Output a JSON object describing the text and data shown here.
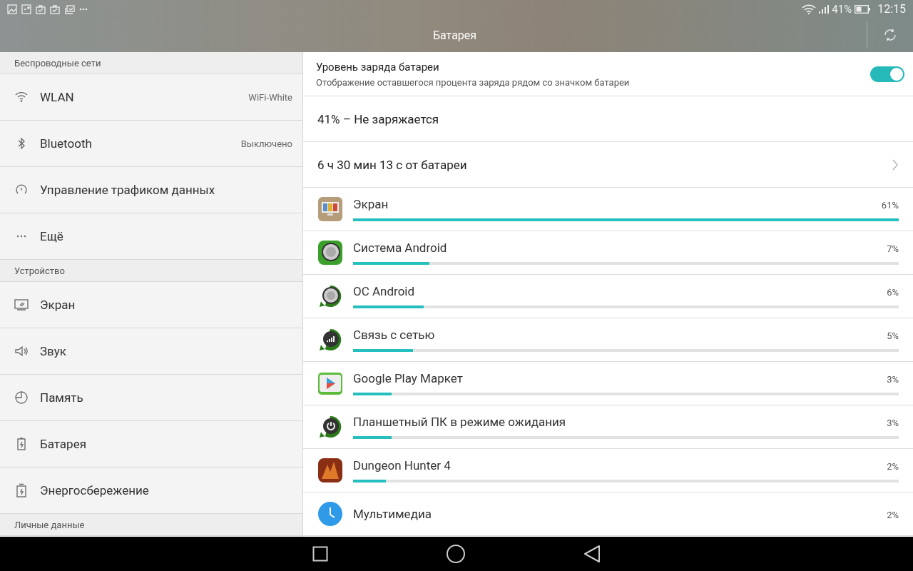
{
  "status_bar": {
    "battery": "41%",
    "time": "12:15"
  },
  "title": "Батарея",
  "sidebar": [
    {
      "kind": "header",
      "label": "Беспроводные сети"
    },
    {
      "kind": "wifi",
      "label": "WLAN",
      "value": "WiFi-White"
    },
    {
      "kind": "bluetooth",
      "label": "Bluetooth",
      "value": "Выключено"
    },
    {
      "kind": "gauge",
      "label": "Управление трафиком данных"
    },
    {
      "kind": "dots",
      "label": "Ещё"
    },
    {
      "kind": "header",
      "label": "Устройство"
    },
    {
      "kind": "monitor",
      "label": "Экран"
    },
    {
      "kind": "speaker",
      "label": "Звук"
    },
    {
      "kind": "pie",
      "label": "Память"
    },
    {
      "kind": "battery",
      "label": "Батарея"
    },
    {
      "kind": "saver",
      "label": "Энергосбережение"
    },
    {
      "kind": "header",
      "label": "Личные данные"
    }
  ],
  "battery_percent_setting": {
    "title": "Уровень заряда батареи",
    "description": "Отображение оставшегося процента заряда рядом со значком батареи",
    "on": true
  },
  "charge_status": "41% – Не заряжается",
  "time_on_battery": "6 ч 30 мин 13 с от батареи",
  "usage": [
    {
      "kind": "display",
      "name": "Экран",
      "percent": "61%",
      "level": 1.0
    },
    {
      "kind": "system",
      "name": "Система Android",
      "percent": "7%",
      "level": 0.14
    },
    {
      "kind": "os",
      "name": "ОС Android",
      "percent": "6%",
      "level": 0.13
    },
    {
      "kind": "network",
      "name": "Связь с сетью",
      "percent": "5%",
      "level": 0.11
    },
    {
      "kind": "store",
      "name": "Google Play Маркет",
      "percent": "3%",
      "level": 0.07
    },
    {
      "kind": "standby",
      "name": "Планшетный ПК в режиме ожидания",
      "percent": "3%",
      "level": 0.07
    },
    {
      "kind": "game",
      "name": "Dungeon Hunter 4",
      "percent": "2%",
      "level": 0.06
    },
    {
      "kind": "media",
      "name": "Мультимедиа",
      "percent": "2%"
    }
  ]
}
